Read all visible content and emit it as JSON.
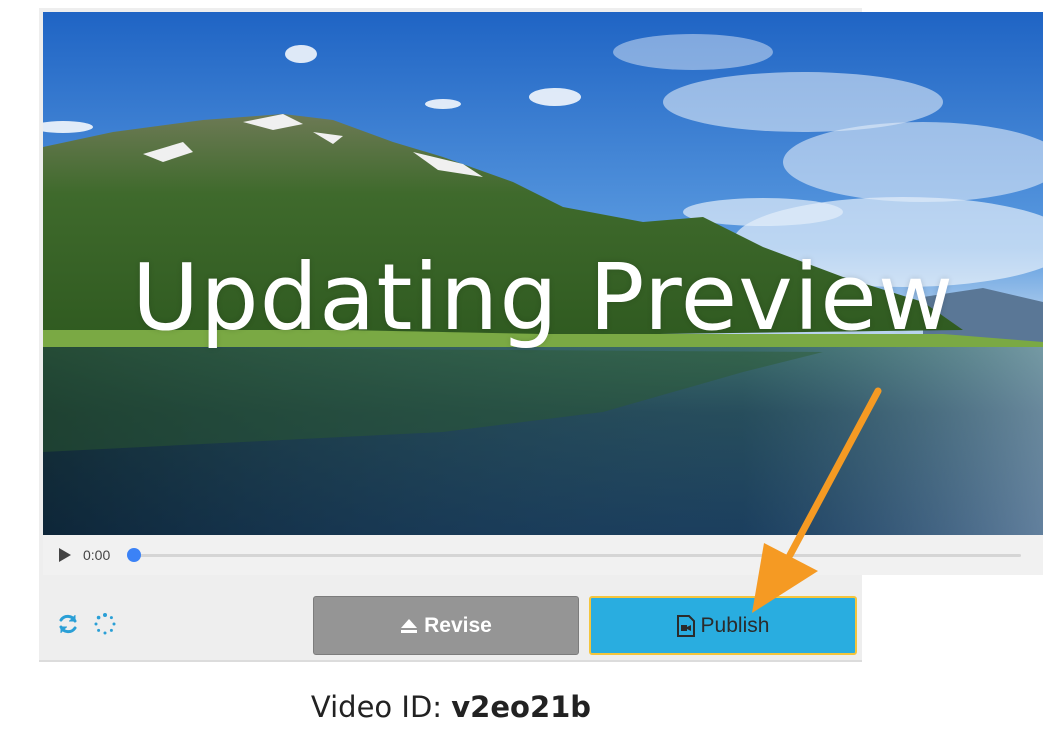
{
  "video": {
    "overlay_title": "Updating Preview",
    "time": "0:00",
    "progress": 0
  },
  "actions": {
    "refresh_icon": "refresh-icon",
    "loading_icon": "spinner-icon",
    "revise_label": "Revise",
    "revise_icon": "eject-icon",
    "publish_label": "Publish",
    "publish_icon": "video-file-icon"
  },
  "footer": {
    "video_id_label": "Video ID:",
    "video_id_value": "v2eo21b"
  },
  "colors": {
    "publish_bg": "#29ade0",
    "publish_border": "#f4c53c",
    "revise_bg": "#959595",
    "progress_knob": "#3b82f6",
    "annotation_arrow": "#f59a23"
  }
}
